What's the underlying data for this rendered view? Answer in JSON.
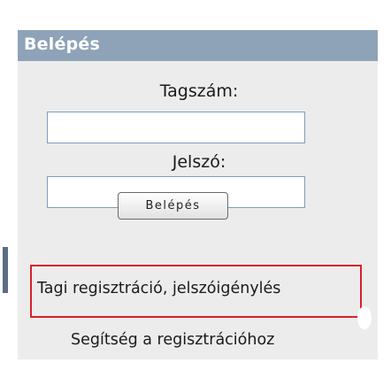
{
  "login_box": {
    "title": "Belépés",
    "member_id_label": "Tagszám:",
    "member_id_value": "",
    "password_label": "Jelszó:",
    "password_value": "",
    "submit_label": "Belépés"
  },
  "links": {
    "register": "Tagi regisztráció, jelszóigénylés",
    "help": "Segítség a regisztrációhoz"
  },
  "colors": {
    "header_bg": "#8ea3b8",
    "panel_bg": "#ececec",
    "highlight": "#d8202a"
  }
}
